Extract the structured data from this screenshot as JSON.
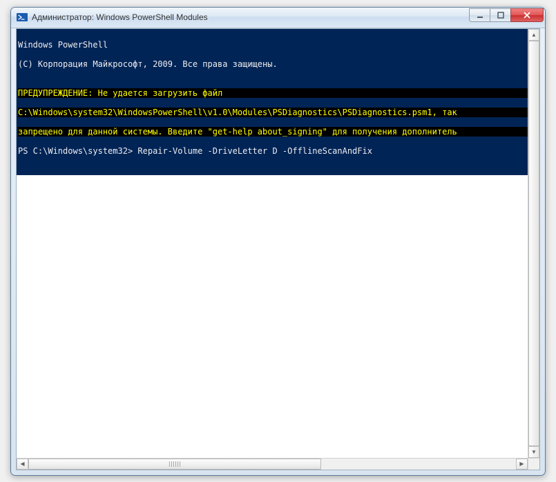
{
  "window": {
    "title": "Администратор: Windows PowerShell Modules"
  },
  "controls": {
    "minimize": "minimize",
    "maximize": "maximize",
    "close": "close"
  },
  "console": {
    "header1": "Windows PowerShell",
    "header2": "(C) Корпорация Майкрософт, 2009. Все права защищены.",
    "blank": "",
    "warn1": "ПРЕДУПРЕЖДЕНИЕ: Не удается загрузить файл",
    "warn2": "C:\\Windows\\system32\\WindowsPowerShell\\v1.0\\Modules\\PSDiagnostics\\PSDiagnostics.psm1, так",
    "warn3": "запрещено для данной системы. Введите \"get-help about_signing\" для получения дополнитель",
    "prompt": "PS C:\\Windows\\system32> ",
    "command": "Repair-Volume -DriveLetter D -OfflineScanAndFix"
  }
}
